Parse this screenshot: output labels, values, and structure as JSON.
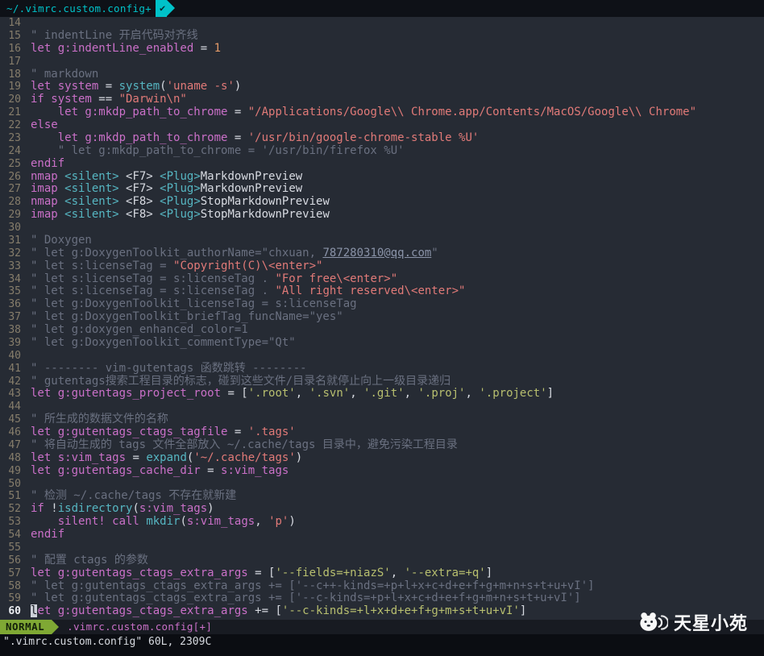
{
  "tabbar": {
    "tab_label": "~/.vimrc.custom.config+",
    "check_icon": "✔"
  },
  "statusbar": {
    "mode": "NORMAL",
    "filename": ".vimrc.custom.config[+]"
  },
  "cmdline": {
    "text": "\".vimrc.custom.config\" 60L, 2309C"
  },
  "watermark": {
    "text": "天星小苑",
    "logo": "panda-logo"
  },
  "palette": {
    "background": "#262b34",
    "tabbar_background": "#0e1117",
    "tab_accent": "#00c2c9",
    "keyword": "#ca70c8",
    "string": "#e17a78",
    "list_string": "#b8bf6f",
    "function": "#56b6c2",
    "comment": "#6a7080",
    "comment_link": "#8a93a8",
    "text": "#d8dbe2",
    "number": "#e39a68",
    "line_number": "#867d6b",
    "current_line_number": "#eceef2",
    "mode_green": "#7fa834",
    "status_pink": "#ca70c8",
    "cursor_block": "#cdd1d9"
  },
  "editor": {
    "lines": [
      {
        "n": 14,
        "s": []
      },
      {
        "n": 15,
        "s": [
          [
            "c",
            "\" indentLine 开启代码对齐线"
          ]
        ]
      },
      {
        "n": 16,
        "s": [
          [
            "k",
            "let g:indentLine_enabled"
          ],
          [
            "w",
            " = "
          ],
          [
            "num",
            "1"
          ]
        ]
      },
      {
        "n": 17,
        "s": []
      },
      {
        "n": 18,
        "s": [
          [
            "c",
            "\" markdown"
          ]
        ]
      },
      {
        "n": 19,
        "s": [
          [
            "k",
            "let system"
          ],
          [
            "w",
            " = "
          ],
          [
            "f",
            "system"
          ],
          [
            "w",
            "("
          ],
          [
            "s",
            "'uname -s'"
          ],
          [
            "w",
            ")"
          ]
        ]
      },
      {
        "n": 20,
        "s": [
          [
            "k",
            "if system"
          ],
          [
            "w",
            " == "
          ],
          [
            "s",
            "\"Darwin\\n\""
          ]
        ]
      },
      {
        "n": 21,
        "s": [
          [
            "w",
            "    "
          ],
          [
            "k",
            "let g:mkdp_path_to_chrome"
          ],
          [
            "w",
            " = "
          ],
          [
            "s",
            "\"/Applications/Google\\\\ Chrome.app/Contents/MacOS/Google\\\\ Chrome\""
          ]
        ]
      },
      {
        "n": 22,
        "s": [
          [
            "k",
            "else"
          ]
        ]
      },
      {
        "n": 23,
        "s": [
          [
            "w",
            "    "
          ],
          [
            "k",
            "let g:mkdp_path_to_chrome"
          ],
          [
            "w",
            " = "
          ],
          [
            "s",
            "'/usr/bin/google-chrome-stable %U'"
          ]
        ]
      },
      {
        "n": 24,
        "s": [
          [
            "c",
            "    \" let g:mkdp_path_to_chrome = '/usr/bin/firefox %U'"
          ]
        ]
      },
      {
        "n": 25,
        "s": [
          [
            "k",
            "endif"
          ]
        ]
      },
      {
        "n": 26,
        "s": [
          [
            "k",
            "nmap"
          ],
          [
            "w",
            " "
          ],
          [
            "f",
            "<silent>"
          ],
          [
            "w",
            " <F7> "
          ],
          [
            "f",
            "<Plug>"
          ],
          [
            "w",
            "MarkdownPreview"
          ]
        ]
      },
      {
        "n": 27,
        "s": [
          [
            "k",
            "imap"
          ],
          [
            "w",
            " "
          ],
          [
            "f",
            "<silent>"
          ],
          [
            "w",
            " <F7> "
          ],
          [
            "f",
            "<Plug>"
          ],
          [
            "w",
            "MarkdownPreview"
          ]
        ]
      },
      {
        "n": 28,
        "s": [
          [
            "k",
            "nmap"
          ],
          [
            "w",
            " "
          ],
          [
            "f",
            "<silent>"
          ],
          [
            "w",
            " <F8> "
          ],
          [
            "f",
            "<Plug>"
          ],
          [
            "w",
            "StopMarkdownPreview"
          ]
        ]
      },
      {
        "n": 29,
        "s": [
          [
            "k",
            "imap"
          ],
          [
            "w",
            " "
          ],
          [
            "f",
            "<silent>"
          ],
          [
            "w",
            " <F8> "
          ],
          [
            "f",
            "<Plug>"
          ],
          [
            "w",
            "StopMarkdownPreview"
          ]
        ]
      },
      {
        "n": 30,
        "s": []
      },
      {
        "n": 31,
        "s": [
          [
            "c",
            "\" Doxygen"
          ]
        ]
      },
      {
        "n": 32,
        "s": [
          [
            "c",
            "\" let g:DoxygenToolkit_authorName=\"chxuan, "
          ],
          [
            "u",
            "787280310@qq.com"
          ],
          [
            "c",
            "\""
          ]
        ]
      },
      {
        "n": 33,
        "s": [
          [
            "c",
            "\" let s:licenseTag = "
          ],
          [
            "s",
            "\"Copyright(C)\\<enter>\""
          ]
        ]
      },
      {
        "n": 34,
        "s": [
          [
            "c",
            "\" let s:licenseTag = s:licenseTag . "
          ],
          [
            "s",
            "\"For free\\<enter>\""
          ]
        ]
      },
      {
        "n": 35,
        "s": [
          [
            "c",
            "\" let s:licenseTag = s:licenseTag . "
          ],
          [
            "s",
            "\"All right reserved\\<enter>\""
          ]
        ]
      },
      {
        "n": 36,
        "s": [
          [
            "c",
            "\" let g:DoxygenToolkit_licenseTag = s:licenseTag"
          ]
        ]
      },
      {
        "n": 37,
        "s": [
          [
            "c",
            "\" let g:DoxygenToolkit_briefTag_funcName=\"yes\""
          ]
        ]
      },
      {
        "n": 38,
        "s": [
          [
            "c",
            "\" let g:doxygen_enhanced_color=1"
          ]
        ]
      },
      {
        "n": 39,
        "s": [
          [
            "c",
            "\" let g:DoxygenToolkit_commentType=\"Qt\""
          ]
        ]
      },
      {
        "n": 40,
        "s": []
      },
      {
        "n": 41,
        "s": [
          [
            "c",
            "\" -------- vim-gutentags 函数跳转 --------"
          ]
        ]
      },
      {
        "n": 42,
        "s": [
          [
            "c",
            "\" gutentags搜索工程目录的标志，碰到这些文件/目录名就停止向上一级目录递归"
          ]
        ]
      },
      {
        "n": 43,
        "s": [
          [
            "k",
            "let g:gutentags_project_root"
          ],
          [
            "w",
            " = ["
          ],
          [
            "g",
            "'.root'"
          ],
          [
            "w",
            ", "
          ],
          [
            "g",
            "'.svn'"
          ],
          [
            "w",
            ", "
          ],
          [
            "g",
            "'.git'"
          ],
          [
            "w",
            ", "
          ],
          [
            "g",
            "'.proj'"
          ],
          [
            "w",
            ", "
          ],
          [
            "g",
            "'.project'"
          ],
          [
            "w",
            "]"
          ]
        ]
      },
      {
        "n": 44,
        "s": []
      },
      {
        "n": 45,
        "s": [
          [
            "c",
            "\" 所生成的数据文件的名称"
          ]
        ]
      },
      {
        "n": 46,
        "s": [
          [
            "k",
            "let g:gutentags_ctags_tagfile"
          ],
          [
            "w",
            " = "
          ],
          [
            "s",
            "'.tags'"
          ]
        ]
      },
      {
        "n": 47,
        "s": [
          [
            "c",
            "\" 将自动生成的 tags 文件全部放入 ~/.cache/tags 目录中，避免污染工程目录"
          ]
        ]
      },
      {
        "n": 48,
        "s": [
          [
            "k",
            "let s:vim_tags"
          ],
          [
            "w",
            " = "
          ],
          [
            "f",
            "expand"
          ],
          [
            "w",
            "("
          ],
          [
            "s",
            "'~/.cache/tags'"
          ],
          [
            "w",
            ")"
          ]
        ]
      },
      {
        "n": 49,
        "s": [
          [
            "k",
            "let g:gutentags_cache_dir"
          ],
          [
            "w",
            " = "
          ],
          [
            "k",
            "s:vim_tags"
          ]
        ]
      },
      {
        "n": 50,
        "s": []
      },
      {
        "n": 51,
        "s": [
          [
            "c",
            "\" 检测 ~/.cache/tags 不存在就新建"
          ]
        ]
      },
      {
        "n": 52,
        "s": [
          [
            "k",
            "if"
          ],
          [
            "w",
            " !"
          ],
          [
            "f",
            "isdirectory"
          ],
          [
            "w",
            "("
          ],
          [
            "k",
            "s:vim_tags"
          ],
          [
            "w",
            ")"
          ]
        ]
      },
      {
        "n": 53,
        "s": [
          [
            "w",
            "    "
          ],
          [
            "k",
            "silent! call"
          ],
          [
            "w",
            " "
          ],
          [
            "f",
            "mkdir"
          ],
          [
            "w",
            "("
          ],
          [
            "k",
            "s:vim_tags"
          ],
          [
            "w",
            ", "
          ],
          [
            "s",
            "'p'"
          ],
          [
            "w",
            ")"
          ]
        ]
      },
      {
        "n": 54,
        "s": [
          [
            "k",
            "endif"
          ]
        ]
      },
      {
        "n": 55,
        "s": []
      },
      {
        "n": 56,
        "s": [
          [
            "c",
            "\" 配置 ctags 的参数"
          ]
        ]
      },
      {
        "n": 57,
        "s": [
          [
            "k",
            "let g:gutentags_ctags_extra_args"
          ],
          [
            "w",
            " = ["
          ],
          [
            "g",
            "'--fields=+niazS'"
          ],
          [
            "w",
            ", "
          ],
          [
            "g",
            "'--extra=+q'"
          ],
          [
            "w",
            "]"
          ]
        ]
      },
      {
        "n": 58,
        "s": [
          [
            "c",
            "\" let g:gutentags_ctags_extra_args += ['--c++-kinds=+p+l+x+c+d+e+f+g+m+n+s+t+u+vI']"
          ]
        ]
      },
      {
        "n": 59,
        "s": [
          [
            "c",
            "\" let g:gutentags_ctags_extra_args += ['--c-kinds=+p+l+x+c+d+e+f+g+m+n+s+t+u+vI']"
          ]
        ]
      },
      {
        "n": 60,
        "cur": true,
        "s": [
          [
            "cur",
            "l"
          ],
          [
            "k",
            "et g:gutentags_ctags_extra_args"
          ],
          [
            "w",
            " += ["
          ],
          [
            "g",
            "'--c-kinds=+l+x+d+e+f+g+m+s+t+u+vI'"
          ],
          [
            "w",
            "]"
          ]
        ]
      }
    ]
  }
}
